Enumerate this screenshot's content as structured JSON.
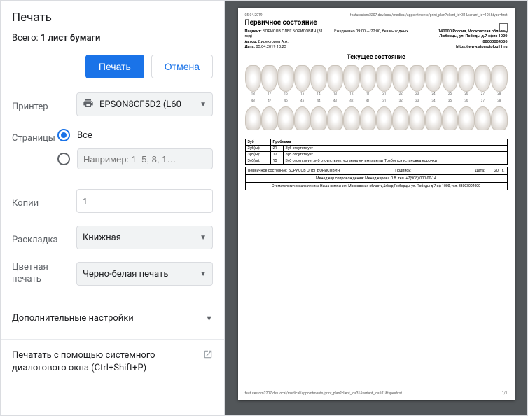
{
  "dialog": {
    "title": "Печать",
    "summary_prefix": "Всего: ",
    "summary_value": "1 лист бумаги",
    "print_btn": "Печать",
    "cancel_btn": "Отмена"
  },
  "labels": {
    "printer": "Принтер",
    "pages": "Страницы",
    "copies": "Копии",
    "layout": "Раскладка",
    "color": "Цветная печать",
    "advanced": "Дополнительные настройки",
    "system": "Печатать с помощью системного диалогового окна (Ctrl+Shift+P)"
  },
  "printer": {
    "selected": "EPSON8CF5D2 (L60"
  },
  "pages": {
    "all_label": "Все",
    "range_placeholder": "Например: 1–5, 8, 1…"
  },
  "copies": {
    "value": "1"
  },
  "layout": {
    "selected": "Книжная"
  },
  "color": {
    "selected": "Черно-белая печать"
  },
  "preview": {
    "date": "05.04.2019",
    "url": "featurestom2207.dev.local/medical/appointments/print_plan?client_id=31&variant_id=101&type=first",
    "title": "Первичное состояние",
    "patient_label": "Пациент:",
    "patient": "БОРИСОВ ОЛЕГ БОРИСОВИЧ (31 год)",
    "author_label": "Автор:",
    "author": "Директоров А.А.",
    "doc_date_label": "Дата:",
    "doc_date": "05.04.2019 10:23",
    "schedule": "Ежедневно 09:00 — 22:00, без выходных",
    "address": "140000 Россия, Московская область, Люберцы, ул. Победы д.7 офис 1000",
    "phone": "88003004000",
    "site": "https://www.stomotolog11.ru",
    "subtitle": "Текущее состояние",
    "upper_nums": [
      "18",
      "17",
      "16",
      "15",
      "14",
      "13",
      "12",
      "11",
      "21",
      "22",
      "23",
      "24",
      "25",
      "26",
      "27",
      "28"
    ],
    "lower_nums": [
      "48",
      "47",
      "46",
      "45",
      "44",
      "43",
      "42",
      "41",
      "31",
      "32",
      "33",
      "34",
      "35",
      "36",
      "37",
      "38"
    ],
    "tbl": {
      "h1": "Зуб",
      "h2": "Проблема",
      "rows": [
        {
          "t": "Зуб(ы):",
          "n": "21",
          "p": "Зуб отсутствует"
        },
        {
          "t": "Зуб(ы):",
          "n": "12",
          "p": "Зуб отсутствует"
        },
        {
          "t": "Зуб(ы):",
          "n": "15",
          "p": "Зуб отсутствует;зуб отсутствует, установлен имплантат;Требуется установка коронки"
        }
      ]
    },
    "sig": {
      "left": "Первичное состояние: БОРИСОВ ОЛЕГ БОРИСОВИЧ",
      "sign": "Подпись:_____",
      "date": "Дата:_____ 20__г."
    },
    "manager": "Менеджер сопровождения: Менеджерова О.В. тел. +7(908) 000-00-14",
    "footer": "Стоматологическая клиника Наша компания. Московская область,&nbsp;Люберцы, ул. Победы д.7 оф 1000, тел. 88003004000",
    "pagenum": "1/1"
  }
}
